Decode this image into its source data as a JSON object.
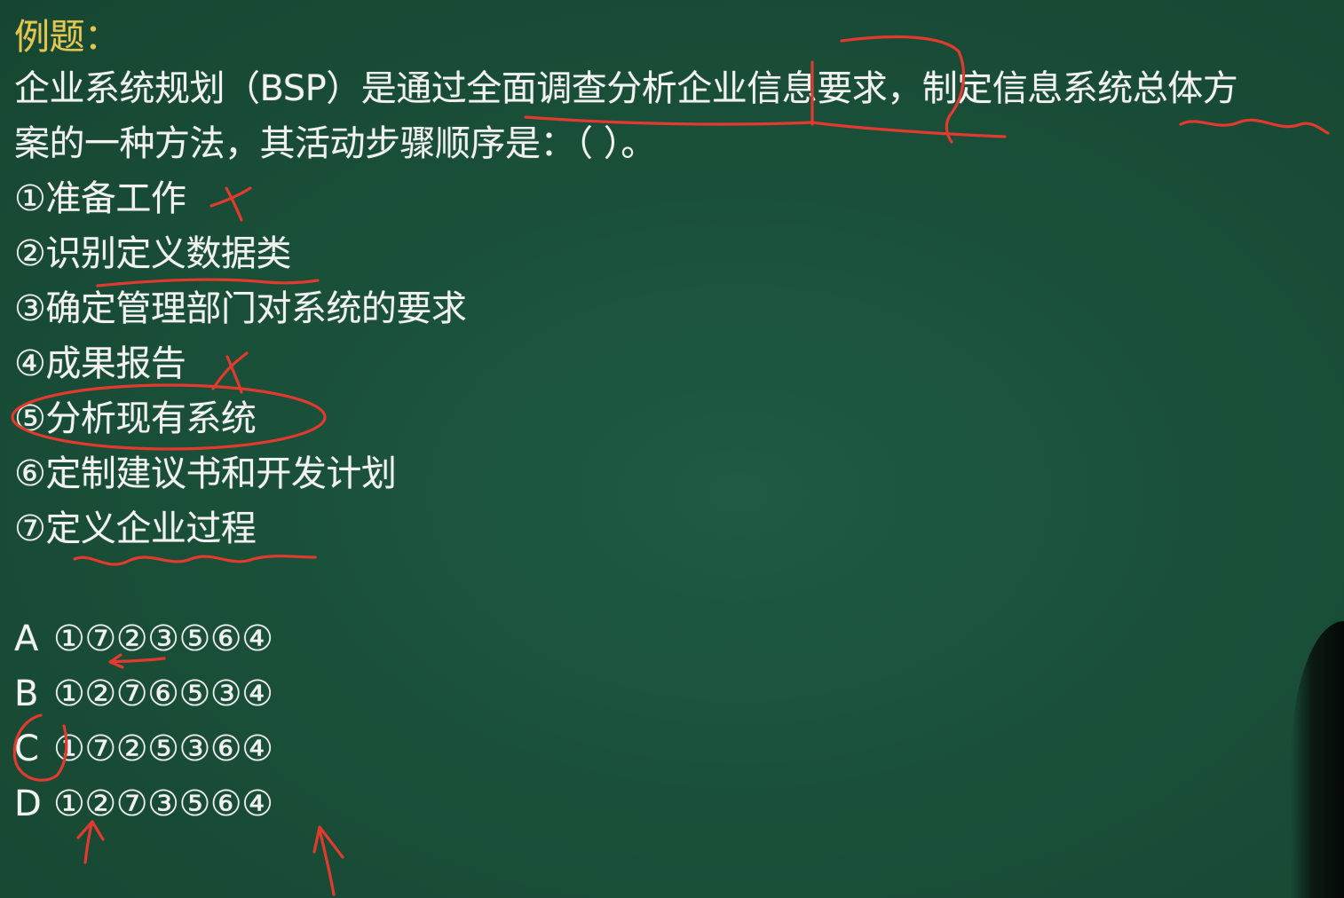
{
  "title": "例题：",
  "question": {
    "line1": "企业系统规划（BSP）是通过全面调查分析企业信息要求，制定信息系统总体方",
    "line2": "案的一种方法，其活动步骤顺序是：（ ）。"
  },
  "steps": [
    "①准备工作",
    "②识别定义数据类",
    "③确定管理部门对系统的要求",
    "④成果报告",
    "⑤分析现有系统",
    "⑥定制建议书和开发计划",
    "⑦定义企业过程"
  ],
  "options": [
    {
      "letter": "A",
      "sequence": "①⑦②③⑤⑥④"
    },
    {
      "letter": "B",
      "sequence": "①②⑦⑥⑤③④"
    },
    {
      "letter": "C",
      "sequence": "①⑦②⑤③⑥④"
    },
    {
      "letter": "D",
      "sequence": "①②⑦③⑤⑥④"
    }
  ],
  "colors": {
    "board": "#1a5039",
    "title": "#e7c64a",
    "text": "#f2f2f2",
    "annotation": "#e23a2f"
  }
}
